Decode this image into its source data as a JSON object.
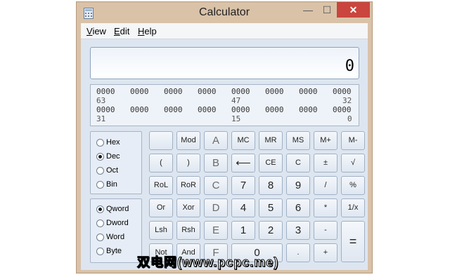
{
  "window": {
    "title": "Calculator",
    "controls": {
      "minimize": "—",
      "maximize": "☐",
      "close": "✕"
    },
    "accent": "#d9c2a8",
    "close_color": "#c9453d"
  },
  "menu": {
    "view": {
      "underline": "V",
      "rest": "iew"
    },
    "edit": {
      "underline": "E",
      "rest": "dit"
    },
    "help": {
      "underline": "H",
      "rest": "elp"
    }
  },
  "display": {
    "value": "0"
  },
  "bits": {
    "row1_groups": [
      "0000",
      "0000",
      "0000",
      "0000",
      "0000",
      "0000",
      "0000",
      "0000"
    ],
    "row1_indices": [
      "63",
      "47",
      "32"
    ],
    "row2_groups": [
      "0000",
      "0000",
      "0000",
      "0000",
      "0000",
      "0000",
      "0000",
      "0000"
    ],
    "row2_indices": [
      "31",
      "15",
      "0"
    ]
  },
  "base_options": [
    {
      "label": "Hex",
      "checked": false
    },
    {
      "label": "Dec",
      "checked": true
    },
    {
      "label": "Oct",
      "checked": false
    },
    {
      "label": "Bin",
      "checked": false
    }
  ],
  "word_options": [
    {
      "label": "Qword",
      "checked": true
    },
    {
      "label": "Dword",
      "checked": false
    },
    {
      "label": "Word",
      "checked": false
    },
    {
      "label": "Byte",
      "checked": false
    }
  ],
  "keys": {
    "blank": "",
    "mod": "Mod",
    "a": "A",
    "mc": "MC",
    "mr": "MR",
    "ms": "MS",
    "mplus": "M+",
    "mminus": "M-",
    "lparen": "(",
    "rparen": ")",
    "b": "B",
    "backspace": "⟵",
    "ce": "CE",
    "c": "C",
    "plusminus": "±",
    "sqrt": "√",
    "rol": "RoL",
    "ror": "RoR",
    "hex_c": "C",
    "seven": "7",
    "eight": "8",
    "nine": "9",
    "divide": "/",
    "percent": "%",
    "or": "Or",
    "xor": "Xor",
    "d": "D",
    "four": "4",
    "five": "5",
    "six": "6",
    "multiply": "*",
    "reciprocal": "1/x",
    "lsh": "Lsh",
    "rsh": "Rsh",
    "e": "E",
    "one": "1",
    "two": "2",
    "three": "3",
    "minus": "-",
    "equals": "=",
    "not": "Not",
    "and": "And",
    "f": "F",
    "zero": "0",
    "dot": ".",
    "plus": "+"
  },
  "watermark": "双电网(www.pcpc.me)"
}
